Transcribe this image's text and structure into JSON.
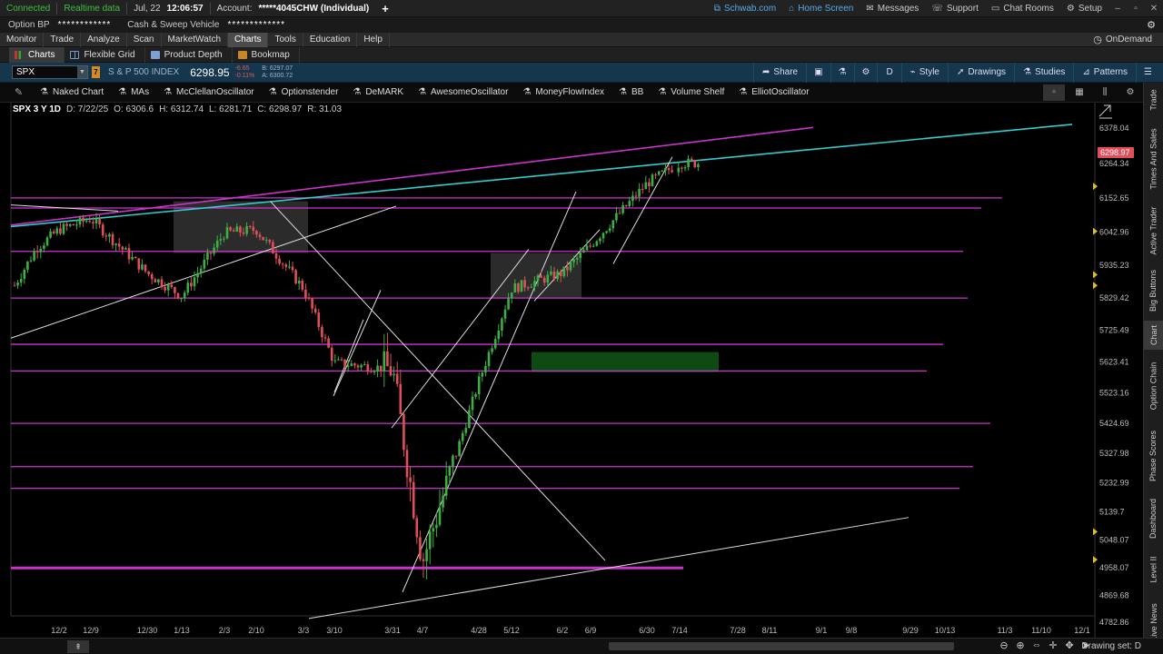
{
  "status_bar": {
    "connection": "Connected",
    "data_mode": "Realtime data",
    "date": "Jul, 22",
    "time": "12:06:57",
    "account_label": "Account:",
    "account_value": "*****4045CHW (Individual)",
    "plus": "+",
    "links": {
      "schwab": "Schwab.com",
      "home": "Home Screen",
      "messages": "Messages",
      "support": "Support",
      "chat": "Chat Rooms",
      "setup": "Setup"
    }
  },
  "account_bar": {
    "option_bp_label": "Option BP",
    "option_bp_value": "************",
    "cash_label": "Cash & Sweep Vehicle",
    "cash_value": "*************"
  },
  "menu": {
    "items": [
      "Monitor",
      "Trade",
      "Analyze",
      "Scan",
      "MarketWatch",
      "Charts",
      "Tools",
      "Education",
      "Help"
    ],
    "active": "Charts",
    "ondemand": "OnDemand"
  },
  "subtabs": {
    "items": [
      "Charts",
      "Flexible Grid",
      "Product Depth",
      "Bookmap"
    ]
  },
  "symbol_bar": {
    "symbol": "SPX",
    "flag": "7",
    "description": "S & P 500 INDEX",
    "price": "6298.95",
    "change": "-6.65",
    "change_pct": "-0.11%",
    "bid": "B: 6297.07",
    "ask": "A: 6300.72",
    "tools": {
      "share": "Share",
      "period": "D",
      "style": "Style",
      "drawings": "Drawings",
      "studies": "Studies",
      "patterns": "Patterns"
    }
  },
  "study_bar": {
    "items": [
      "Naked Chart",
      "MAs",
      "McClellanOscillator",
      "Optionstender",
      "DeMARK",
      "AwesomeOscillator",
      "MoneyFlowIndex",
      "BB",
      "Volume Shelf",
      "ElliotOscillator"
    ]
  },
  "chart_header": {
    "title": "SPX 3 Y 1D",
    "date": "D: 7/22/25",
    "open": "O: 6306.6",
    "high": "H: 6312.74",
    "low": "L: 6281.71",
    "close": "C: 6298.97",
    "range": "R: 31.03"
  },
  "side_tabs": [
    "Trade",
    "Times And Sales",
    "Active Trader",
    "Big Buttons",
    "Chart",
    "Option Chain",
    "Phase Scores",
    "Dashboard",
    "Level II",
    "Live News"
  ],
  "bottom_bar": {
    "drawing_set": "Drawing set: D"
  },
  "colors": {
    "up": "#3cb043",
    "down": "#e0505a",
    "magenta": "#cc33cc",
    "cyan": "#33cccc",
    "price_tag": "#e0505a"
  },
  "chart_data": {
    "type": "candlestick",
    "symbol": "SPX",
    "aggregation": "1D",
    "y_axis_ticks": [
      6378.04,
      6264.34,
      6152.65,
      6042.96,
      5935.23,
      5829.42,
      5725.49,
      5623.41,
      5523.16,
      5424.69,
      5327.98,
      5232.99,
      5139.7,
      5048.07,
      4958.07,
      4869.68,
      4782.86
    ],
    "ylim": [
      4782.86,
      6378.04
    ],
    "x_axis_ticks": [
      "12/2",
      "12/9",
      "12/30",
      "1/13",
      "2/3",
      "2/10",
      "3/3",
      "3/10",
      "3/31",
      "4/7",
      "4/28",
      "5/12",
      "6/2",
      "6/9",
      "6/30",
      "7/14",
      "7/28",
      "8/11",
      "9/1",
      "9/8",
      "9/29",
      "10/13",
      "11/3",
      "11/10",
      "12/1"
    ],
    "last_price": "6298.97",
    "horizontal_levels": [
      6152.65,
      6120,
      5980,
      5829.42,
      5680,
      5594,
      5424.69,
      5285,
      5215,
      4958.07
    ],
    "path": [
      [
        "12/2",
        6050
      ],
      [
        "12/9",
        6085
      ],
      [
        "12/30",
        5910
      ],
      [
        "1/13",
        5835
      ],
      [
        "2/3",
        6040
      ],
      [
        "2/10",
        6050
      ],
      [
        "3/3",
        5860
      ],
      [
        "3/10",
        5620
      ],
      [
        "3/31",
        5600
      ],
      [
        "4/7",
        4980
      ],
      [
        "4/28",
        5560
      ],
      [
        "5/12",
        5860
      ],
      [
        "6/2",
        5910
      ],
      [
        "6/9",
        6000
      ],
      [
        "6/30",
        6200
      ],
      [
        "7/14",
        6265
      ]
    ]
  }
}
